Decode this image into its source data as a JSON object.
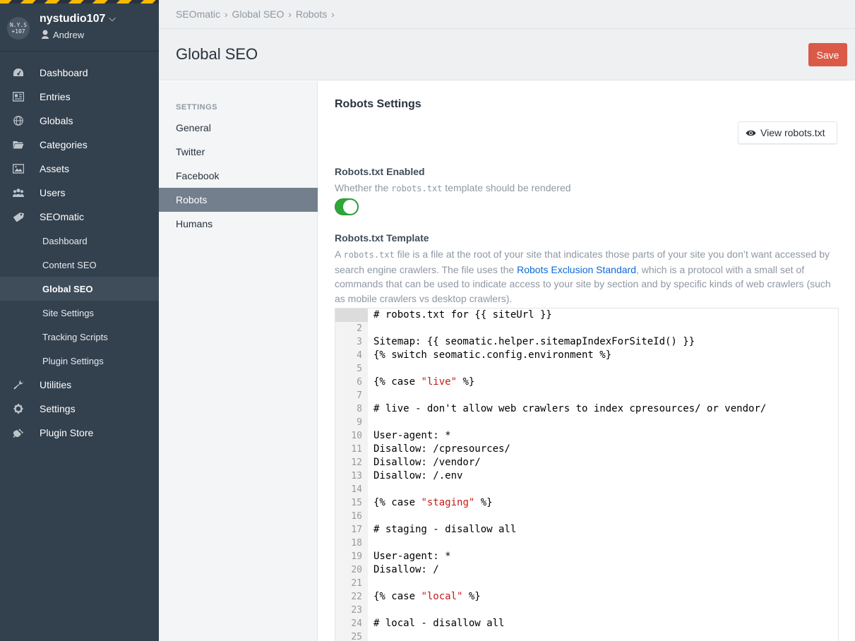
{
  "site": {
    "name": "nystudio107",
    "logo_text": "NYS 107",
    "user": "Andrew"
  },
  "nav": {
    "items": [
      {
        "label": "Dashboard",
        "icon": "dashboard-icon"
      },
      {
        "label": "Entries",
        "icon": "entries-icon"
      },
      {
        "label": "Globals",
        "icon": "globe-icon"
      },
      {
        "label": "Categories",
        "icon": "folder-icon"
      },
      {
        "label": "Assets",
        "icon": "image-icon"
      },
      {
        "label": "Users",
        "icon": "users-icon"
      },
      {
        "label": "SEOmatic",
        "icon": "seomatic-icon"
      }
    ],
    "seomatic_sub": [
      "Dashboard",
      "Content SEO",
      "Global SEO",
      "Site Settings",
      "Tracking Scripts",
      "Plugin Settings"
    ],
    "bottom_items": [
      {
        "label": "Utilities",
        "icon": "wrench-icon"
      },
      {
        "label": "Settings",
        "icon": "gear-icon"
      },
      {
        "label": "Plugin Store",
        "icon": "plug-icon"
      }
    ]
  },
  "breadcrumbs": [
    "SEOmatic",
    "Global SEO",
    "Robots"
  ],
  "page_title": "Global SEO",
  "save_label": "Save",
  "subnav": {
    "heading": "SETTINGS",
    "items": [
      "General",
      "Twitter",
      "Facebook",
      "Robots",
      "Humans"
    ],
    "selected": "Robots"
  },
  "content": {
    "title": "Robots Settings",
    "view_button": "View robots.txt",
    "enabled_label": "Robots.txt Enabled",
    "enabled_instr_pre": "Whether the ",
    "enabled_instr_code": "robots.txt",
    "enabled_instr_post": " template should be rendered",
    "enabled": true,
    "template_label": "Robots.txt Template",
    "template_instr_1": "A ",
    "template_instr_code": "robots.txt",
    "template_instr_2": " file is a file at the root of your site that indicates those parts of your site you don’t want accessed by search engine crawlers. The file uses the ",
    "template_instr_link": "Robots Exclusion Standard",
    "template_instr_3": ", which is a protocol with a small set of commands that can be used to indicate access to your site by section and by specific kinds of web crawlers (such as mobile crawlers vs desktop crawlers)."
  },
  "code_lines": [
    "# robots.txt for {{ siteUrl }}",
    "",
    "Sitemap: {{ seomatic.helper.sitemapIndexForSiteId() }}",
    "{% switch seomatic.config.environment %}",
    "",
    "{% case \"live\" %}",
    "",
    "# live - don't allow web crawlers to index cpresources/ or vendor/",
    "",
    "User-agent: *",
    "Disallow: /cpresources/",
    "Disallow: /vendor/",
    "Disallow: /.env",
    "",
    "{% case \"staging\" %}",
    "",
    "# staging - disallow all",
    "",
    "User-agent: *",
    "Disallow: /",
    "",
    "{% case \"local\" %}",
    "",
    "# local - disallow all",
    ""
  ],
  "colors": {
    "sidebar": "#33404d",
    "save": "#da5a47",
    "toggle": "#2fa63a",
    "link": "#0b69d4",
    "string": "#c41a16"
  }
}
